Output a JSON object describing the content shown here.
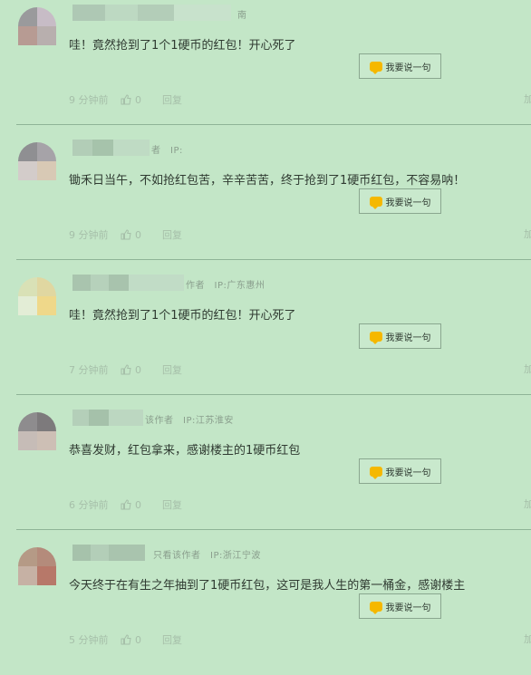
{
  "reply_button_label": "我要说一句",
  "reply_link_label": "回复",
  "edge_label": "加",
  "comments": [
    {
      "meta": "南",
      "text": "哇！竟然抢到了1个1硬币的红包！开心死了",
      "time": "9 分钟前",
      "likes": "0"
    },
    {
      "meta": "者　IP:",
      "text": "锄禾日当午，不如抢红包苦，辛辛苦苦，终于抢到了1硬币红包，不容易呐！",
      "time": "9 分钟前",
      "likes": "0"
    },
    {
      "meta": "作者　IP:广东惠州",
      "text": "哇！竟然抢到了1个1硬币的红包！开心死了",
      "time": "7 分钟前",
      "likes": "0"
    },
    {
      "meta": "该作者　IP:江苏淮安",
      "text": "恭喜发财，红包拿来，感谢楼主的1硬币红包",
      "time": "6 分钟前",
      "likes": "0"
    },
    {
      "meta": "只看该作者　IP:浙江宁波",
      "text": "今天终于在有生之年抽到了1硬币红包，这可是我人生的第一桶金，感谢楼主",
      "time": "5 分钟前",
      "likes": "0"
    }
  ],
  "colors": {
    "background": "#c3e6c7",
    "divider": "#8fb497",
    "icon": "#f5b800"
  }
}
